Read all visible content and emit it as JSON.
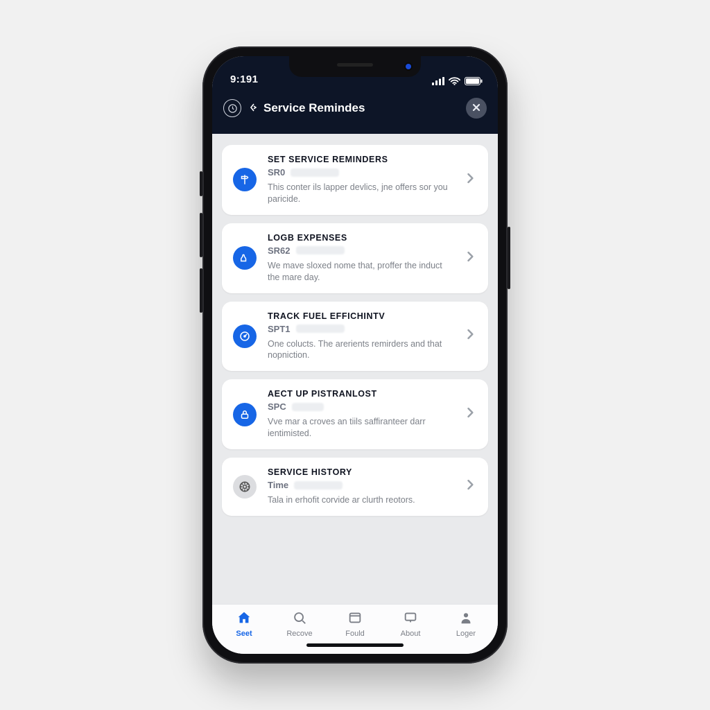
{
  "status": {
    "time": "9:191"
  },
  "nav": {
    "title": "Service Remindes"
  },
  "items": [
    {
      "title": "SET SERVICE REMINDERS",
      "code": "SR0",
      "desc": "This conter ils lapper devlics, jne offers sor you paricide.",
      "icon": "signpost-icon",
      "variant": "blue"
    },
    {
      "title": "LoGB EXPENSES",
      "code": "SR62",
      "desc": "We mave sloxed nome that, proffer the induct the mare day.",
      "icon": "pipe-icon",
      "variant": "blue"
    },
    {
      "title": "TRACK FUEL EFfICHiNTV",
      "code": "SPT1",
      "desc": "One colucts. The arerients remirders and that nopniction.",
      "icon": "gauge-icon",
      "variant": "blue"
    },
    {
      "title": "AeCT UP PiSTRANLOST",
      "code": "SPC",
      "desc": "Vve mar a croves an tiils saffiranteer darr ientimisted.",
      "icon": "lock-icon",
      "variant": "blue"
    },
    {
      "title": "SERVICE HISTORY",
      "code": "Time",
      "desc": "Tala in erhofit corvide ar clurth reotors.",
      "icon": "tire-icon",
      "variant": "grey"
    }
  ],
  "tabs": [
    {
      "label": "Seet",
      "icon": "home-icon",
      "active": true
    },
    {
      "label": "Recove",
      "icon": "search-icon",
      "active": false
    },
    {
      "label": "Fould",
      "icon": "window-icon",
      "active": false
    },
    {
      "label": "About",
      "icon": "monitor-icon",
      "active": false
    },
    {
      "label": "Loger",
      "icon": "person-icon",
      "active": false
    }
  ],
  "colors": {
    "accent": "#1766e6",
    "navbar": "#0d1527"
  }
}
